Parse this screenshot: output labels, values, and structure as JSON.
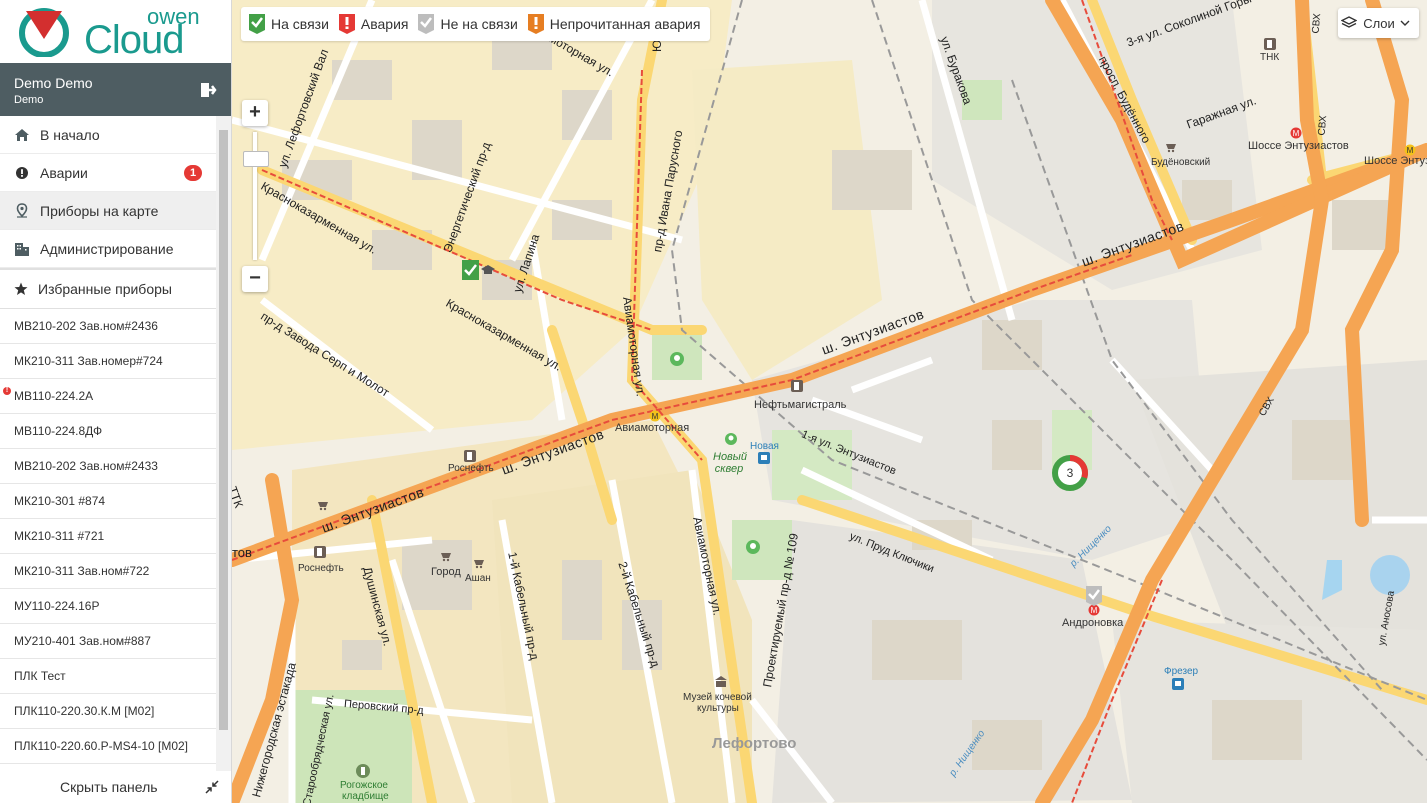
{
  "brand": {
    "owen": "owen",
    "cloud": "Cloud"
  },
  "user": {
    "name": "Demo Demo",
    "org": "Demo"
  },
  "nav": {
    "items": [
      {
        "label": "В начало",
        "icon": "home-icon"
      },
      {
        "label": "Аварии",
        "icon": "alert-circle-icon",
        "badge": "1"
      },
      {
        "label": "Приборы на карте",
        "icon": "map-pin-icon"
      },
      {
        "label": "Администрирование",
        "icon": "building-icon"
      }
    ],
    "favorites_label": "Избранные приборы"
  },
  "devices": [
    {
      "label": "МВ210-202 Зав.ном#2436",
      "alarm": false
    },
    {
      "label": "МК210-311 Зав.номер#724",
      "alarm": false
    },
    {
      "label": "МВ110-224.2А",
      "alarm": true
    },
    {
      "label": "МВ110-224.8ДФ",
      "alarm": false
    },
    {
      "label": "МВ210-202 Зав.ном#2433",
      "alarm": false
    },
    {
      "label": "МК210-301 #874",
      "alarm": false
    },
    {
      "label": "МК210-311 #721",
      "alarm": false
    },
    {
      "label": "МК210-311 Зав.ном#722",
      "alarm": false
    },
    {
      "label": "МУ110-224.16Р",
      "alarm": false
    },
    {
      "label": "МУ210-401 Зав.ном#887",
      "alarm": false
    },
    {
      "label": "ПЛК Тест",
      "alarm": false
    },
    {
      "label": "ПЛК110-220.30.К.М [M02]",
      "alarm": false
    },
    {
      "label": "ПЛК110-220.60.Р-MS4-10 [M02]",
      "alarm": false
    }
  ],
  "hide_panel": "Скрыть панель",
  "legend": {
    "online": "На связи",
    "alarm": "Авария",
    "offline": "Не на связи",
    "unread_alarm": "Непрочитанная авария",
    "colors": {
      "online": "#43a047",
      "alarm": "#e53935",
      "offline": "#bdbdbd",
      "unread": "#e67e22"
    }
  },
  "map": {
    "layers_label": "Слои",
    "zoom_in": "+",
    "zoom_out": "−",
    "cluster": {
      "count": "3"
    },
    "streets": {
      "entuziastov_1": "ш. Энтузиастов",
      "entuziastov_2": "ш. Энтузиастов",
      "entuziastov_3": "ш. Энтузиастов",
      "entuziastov_4": "ш. Энтузиастов",
      "krasnokazarm_1": "Красноказарменная ул.",
      "krasnokazarm_2": "Красноказарменная ул.",
      "aviamotornaya_1": "Авиамоторная ул.",
      "aviamotornaya_2": "Авиамоторная ул.",
      "aviamotornaya_3": "Авиамоторная ул.",
      "budennogo": "просп. Будённого",
      "garazhnaya": "Гаражная ул.",
      "sokolinoy": "3-я ул. Соколиной Горы",
      "burakova": "ул. Буракова",
      "parystogo": "пр-д Ивана Парусного",
      "lapina": "ул. Лапина",
      "energetichesky": "Энергетический пр-д",
      "lefortovsky": "ул. Лефортовский Вал",
      "serp": "пр-д Завода Серп и Молот",
      "dushinskaya": "Душинская ул.",
      "kabelny1": "1-й Кабельный пр-д",
      "kabelny2": "2-й Кабельный пр-д",
      "proektiruemy": "Проектируемый пр-д № 109",
      "perovsky": "Перовский пр-д",
      "staroobryad": "Старообрядческая ул.",
      "nizhegorod": "Нижегородская эстакада",
      "prud": "ул. Пруд Ключики",
      "entuz1": "1-я ул. Энтузиастов",
      "anosova": "ул. Аносова",
      "nishchenko1": "р. Нищенко",
      "nishchenko2": "р. Нищенко",
      "yuzhny": "Южн",
      "ttk": "ТТК",
      "tov": "тов",
      "svh1": "СВХ",
      "svh2": "СВХ",
      "svh3": "СВХ",
      "aviamotornaya_up": "моторная ул."
    },
    "places": {
      "aviamotornaya_metro": "Авиамоторная",
      "shosse_entuz": "Шоссе Энтузиастов",
      "shosse_entuz2": "Шоссе Энтузиастов",
      "andronovka": "Андроновка",
      "neftmagistral": "Нефтьмагистраль",
      "rosneft1": "Роснефть",
      "rosneft2": "Роснефть",
      "budenovsky": "Будёновский",
      "tnk": "ТНК",
      "gorod": "Город",
      "ashan": "Ашан",
      "novaya": "Новая",
      "novy_skver": "Новый сквер",
      "museum_line1": "Музей кочевой",
      "museum_line2": "культуры",
      "lefortovo": "Лефортово",
      "frezer": "Фрезер",
      "rogozhskoe_1": "Рогожское",
      "rogozhskoe_2": "кладбище"
    }
  }
}
